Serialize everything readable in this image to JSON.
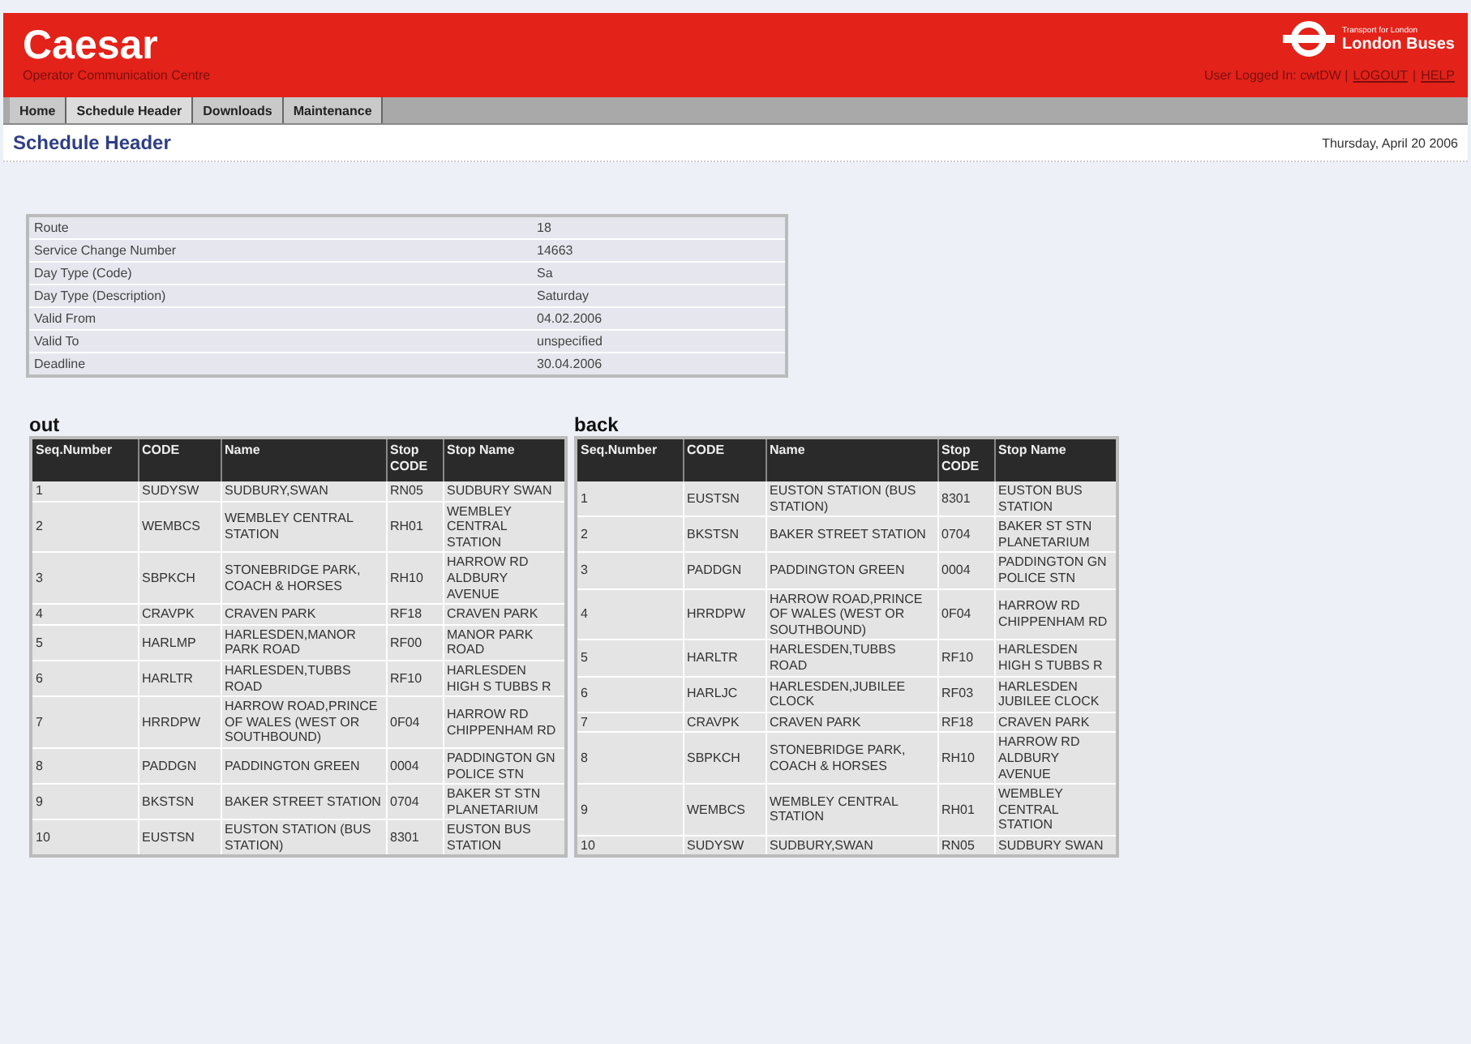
{
  "header": {
    "title": "Caesar",
    "subtitle": "Operator Communication Centre",
    "logo_small": "Transport for London",
    "logo_name": "London Buses",
    "user_text": "User Logged In: cwtDW |",
    "logout": "LOGOUT",
    "separator": "|",
    "help": "HELP"
  },
  "nav": [
    {
      "label": "Home",
      "selected": false
    },
    {
      "label": "Schedule Header",
      "selected": true
    },
    {
      "label": "Downloads",
      "selected": false
    },
    {
      "label": "Maintenance",
      "selected": false
    }
  ],
  "page_title": "Schedule Header",
  "date": "Thursday, April 20 2006",
  "info": [
    [
      "Route",
      "18"
    ],
    [
      "Service Change Number",
      "14663"
    ],
    [
      "Day Type (Code)",
      "Sa"
    ],
    [
      "Day Type (Description)",
      "Saturday"
    ],
    [
      "Valid From",
      "04.02.2006"
    ],
    [
      "Valid To",
      "unspecified"
    ],
    [
      "Deadline",
      "30.04.2006"
    ]
  ],
  "directions": [
    {
      "title": "out",
      "columns": [
        "Seq.Number",
        "CODE",
        "Name",
        "Stop CODE",
        "Stop Name"
      ],
      "rows": [
        [
          "1",
          "SUDYSW",
          "SUDBURY,SWAN",
          "RN05",
          "SUDBURY SWAN"
        ],
        [
          "2",
          "WEMBCS",
          "WEMBLEY CENTRAL STATION",
          "RH01",
          "WEMBLEY CENTRAL STATION"
        ],
        [
          "3",
          "SBPKCH",
          "STONEBRIDGE PARK, COACH & HORSES",
          "RH10",
          "HARROW RD ALDBURY AVENUE"
        ],
        [
          "4",
          "CRAVPK",
          "CRAVEN PARK",
          "RF18",
          "CRAVEN PARK"
        ],
        [
          "5",
          "HARLMP",
          "HARLESDEN,MANOR PARK ROAD",
          "RF00",
          "MANOR PARK ROAD"
        ],
        [
          "6",
          "HARLTR",
          "HARLESDEN,TUBBS ROAD",
          "RF10",
          "HARLESDEN HIGH S TUBBS R"
        ],
        [
          "7",
          "HRRDPW",
          "HARROW ROAD,PRINCE OF WALES (WEST OR SOUTHBOUND)",
          "0F04",
          "HARROW RD CHIPPENHAM RD"
        ],
        [
          "8",
          "PADDGN",
          "PADDINGTON GREEN",
          "0004",
          "PADDINGTON GN POLICE STN"
        ],
        [
          "9",
          "BKSTSN",
          "BAKER STREET STATION",
          "0704",
          "BAKER ST STN PLANETARIUM"
        ],
        [
          "10",
          "EUSTSN",
          "EUSTON STATION (BUS STATION)",
          "8301",
          "EUSTON BUS STATION"
        ]
      ]
    },
    {
      "title": "back",
      "columns": [
        "Seq.Number",
        "CODE",
        "Name",
        "Stop CODE",
        "Stop Name"
      ],
      "rows": [
        [
          "1",
          "EUSTSN",
          "EUSTON STATION (BUS STATION)",
          "8301",
          "EUSTON BUS STATION"
        ],
        [
          "2",
          "BKSTSN",
          "BAKER STREET STATION",
          "0704",
          "BAKER ST STN PLANETARIUM"
        ],
        [
          "3",
          "PADDGN",
          "PADDINGTON GREEN",
          "0004",
          "PADDINGTON GN POLICE STN"
        ],
        [
          "4",
          "HRRDPW",
          "HARROW ROAD,PRINCE OF WALES (WEST OR SOUTHBOUND)",
          "0F04",
          "HARROW RD CHIPPENHAM RD"
        ],
        [
          "5",
          "HARLTR",
          "HARLESDEN,TUBBS ROAD",
          "RF10",
          "HARLESDEN HIGH S TUBBS R"
        ],
        [
          "6",
          "HARLJC",
          "HARLESDEN,JUBILEE CLOCK",
          "RF03",
          "HARLESDEN JUBILEE CLOCK"
        ],
        [
          "7",
          "CRAVPK",
          "CRAVEN PARK",
          "RF18",
          "CRAVEN PARK"
        ],
        [
          "8",
          "SBPKCH",
          "STONEBRIDGE PARK, COACH & HORSES",
          "RH10",
          "HARROW RD ALDBURY AVENUE"
        ],
        [
          "9",
          "WEMBCS",
          "WEMBLEY CENTRAL STATION",
          "RH01",
          "WEMBLEY CENTRAL STATION"
        ],
        [
          "10",
          "SUDYSW",
          "SUDBURY,SWAN",
          "RN05",
          "SUDBURY SWAN"
        ]
      ]
    }
  ]
}
